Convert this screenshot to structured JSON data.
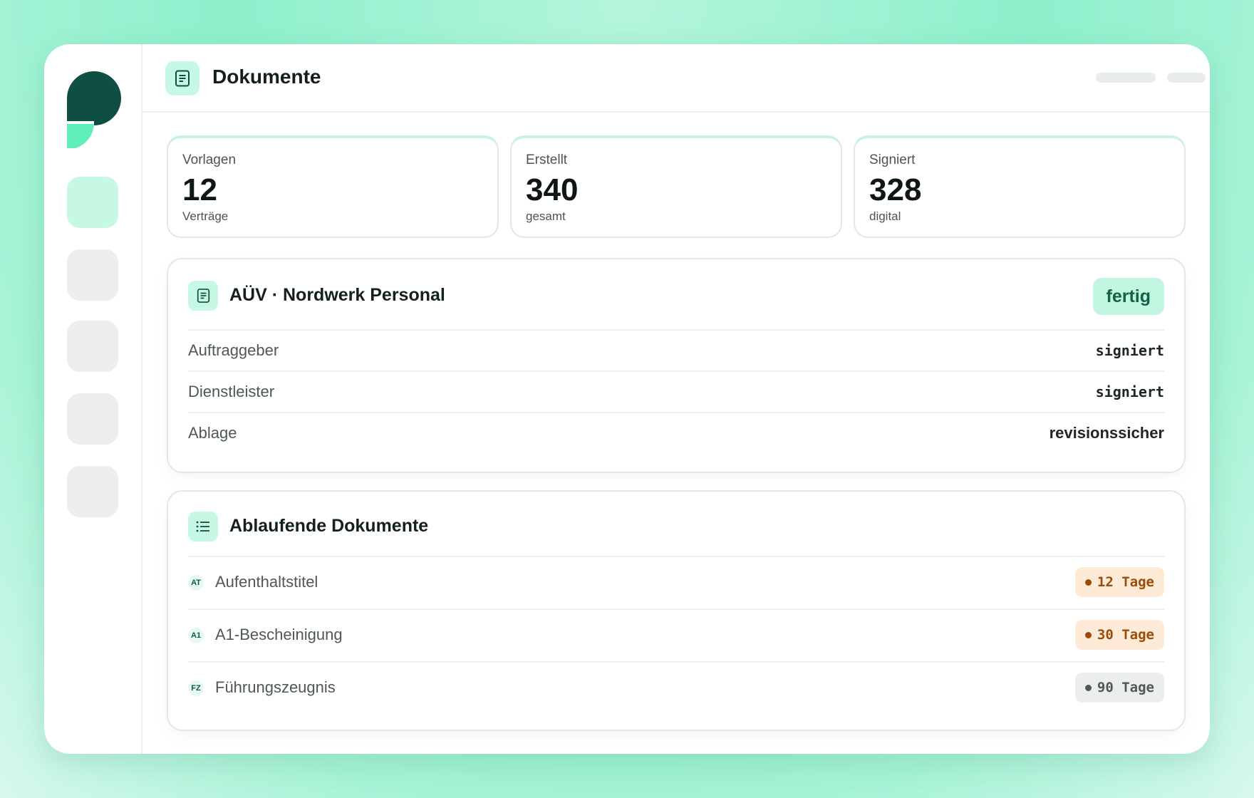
{
  "header": {
    "title": "Dokumente"
  },
  "stats": [
    {
      "label": "Vorlagen",
      "value": "12",
      "sub": "Verträge"
    },
    {
      "label": "Erstellt",
      "value": "340",
      "sub": "gesamt"
    },
    {
      "label": "Signiert",
      "value": "328",
      "sub": "digital"
    }
  ],
  "contract": {
    "title": "AÜV · Nordwerk Personal",
    "status": "fertig",
    "rows": [
      {
        "label": "Auftraggeber",
        "value": "signiert"
      },
      {
        "label": "Dienstleister",
        "value": "signiert"
      },
      {
        "label": "Ablage",
        "value": "revisionssicher"
      }
    ]
  },
  "expiring": {
    "title": "Ablaufende Dokumente",
    "items": [
      {
        "abbr": "AT",
        "name": "Aufenthaltstitel",
        "days": "12 Tage",
        "tone": "warning"
      },
      {
        "abbr": "A1",
        "name": "A1-Bescheinigung",
        "days": "30 Tage",
        "tone": "warning"
      },
      {
        "abbr": "FZ",
        "name": "Führungszeugnis",
        "days": "90 Tage",
        "tone": "neutral"
      }
    ]
  },
  "colors": {
    "accent": "#37e0a6",
    "accent_soft": "#c6f8e4",
    "brand_dark": "#0f4f43",
    "warning_bg": "#fdebd8",
    "warning_fg": "#9a4c08",
    "neutral_bg": "#eceeed",
    "neutral_fg": "#4e5854"
  },
  "icons": {
    "logo": "brand-logo",
    "title": "document-icon",
    "contract": "document-icon",
    "expiring": "list-icon"
  }
}
